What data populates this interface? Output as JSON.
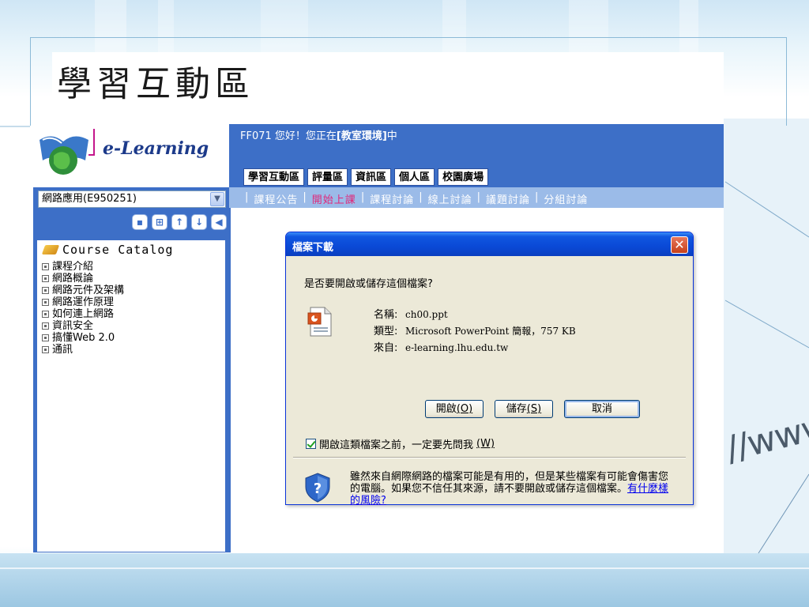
{
  "slide": {
    "title": "學習互動區",
    "decor_text": "//www"
  },
  "app": {
    "logo_text": "e-Learning",
    "greeting_prefix": "FF071 您好！您正在",
    "greeting_location": "[教室環境]",
    "greeting_suffix": "中",
    "main_tabs": [
      "學習互動區",
      "評量區",
      "資訊區",
      "個人區",
      "校園廣場"
    ],
    "sub_nav": [
      "課程公告",
      "開始上課",
      "課程討論",
      "線上討論",
      "議題討論",
      "分組討論"
    ],
    "sub_nav_active": "開始上課",
    "course_select": "網路應用(E950251)",
    "catalog_title": "Course Catalog",
    "catalog_items": [
      "課程介紹",
      "網路概論",
      "網路元件及架構",
      "網路運作原理",
      "如何連上網路",
      "資訊安全",
      "搞懂Web 2.0",
      "通訊"
    ]
  },
  "dialog": {
    "title": "檔案下載",
    "question": "是否要開啟或儲存這個檔案?",
    "name_label": "名稱:",
    "name_value": "ch00.ppt",
    "type_label": "類型:",
    "type_value": "Microsoft PowerPoint 簡報，757 KB",
    "from_label": "來自:",
    "from_value": "e-learning.lhu.edu.tw",
    "open_label": "開啟",
    "open_key": "(O)",
    "save_label": "儲存",
    "save_key": "(S)",
    "cancel_label": "取消",
    "checkbox_text": "開啟這類檔案之前，一定要先問我",
    "checkbox_key": "(W)",
    "checkbox_checked": true,
    "warning_text": "雖然來自網際網路的檔案可能是有用的，但是某些檔案有可能會傷害您的電腦。如果您不信任其來源，請不要開啟或儲存這個檔案。",
    "warning_link": "有什麼樣的風險?"
  },
  "colors": {
    "brand_blue": "#3d6fc7",
    "sub_bar": "#9bbbe8",
    "active_nav": "#e0287a",
    "xp_title": "#0a49d6"
  }
}
